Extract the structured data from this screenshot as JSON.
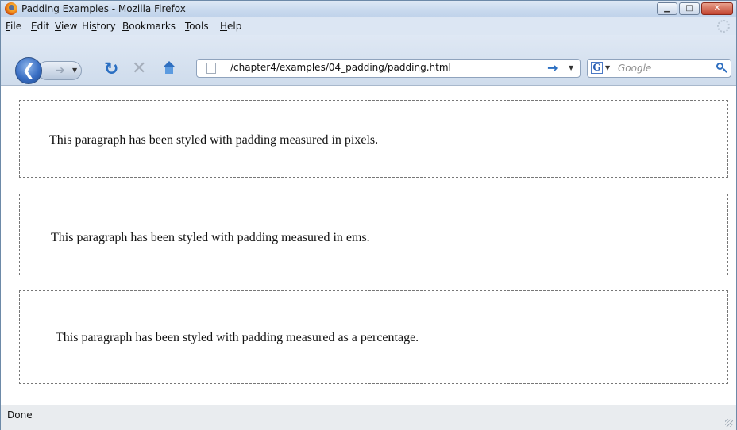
{
  "window": {
    "title": "Padding Examples - Mozilla Firefox"
  },
  "menubar": {
    "items": [
      {
        "label": "File",
        "accel": "F"
      },
      {
        "label": "Edit",
        "accel": "E"
      },
      {
        "label": "View",
        "accel": "V"
      },
      {
        "label": "History",
        "accel": "s"
      },
      {
        "label": "Bookmarks",
        "accel": "B"
      },
      {
        "label": "Tools",
        "accel": "T"
      },
      {
        "label": "Help",
        "accel": "H"
      }
    ]
  },
  "toolbar": {
    "back_icon": "back-arrow-icon",
    "forward_icon": "forward-arrow-icon",
    "reload_icon": "reload-icon",
    "stop_icon": "stop-icon",
    "home_icon": "home-icon"
  },
  "address": {
    "url": "/chapter4/examples/04_padding/padding.html"
  },
  "search": {
    "placeholder": "Google",
    "engine_letter": "G"
  },
  "content": {
    "paragraphs": [
      "This paragraph has been styled with padding measured in pixels.",
      "This paragraph has been styled with padding measured in ems.",
      "This paragraph has been styled with padding measured as a percentage."
    ]
  },
  "status": {
    "text": "Done"
  }
}
